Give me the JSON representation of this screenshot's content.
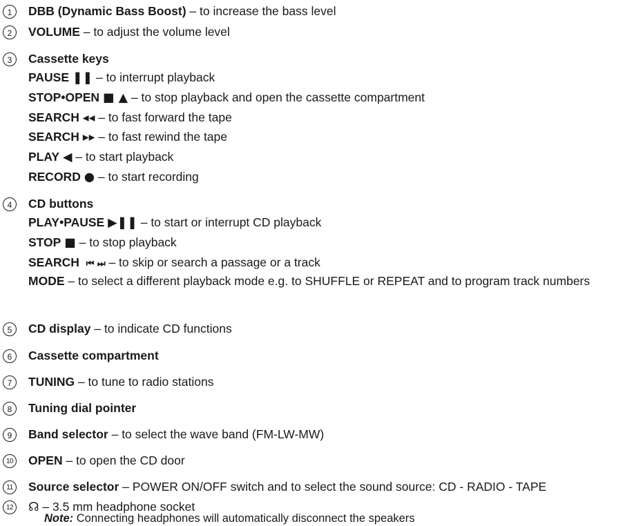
{
  "items": [
    {
      "n": "1",
      "bold": "DBB (Dynamic Bass Boost)",
      "text": " – to increase the bass level"
    },
    {
      "n": "2",
      "bold": "VOLUME",
      "text": " – to adjust the volume level"
    },
    {
      "n": "3",
      "bold": "Cassette keys",
      "text": "",
      "subs": [
        {
          "bold": "PAUSE",
          "sym": "❚❚",
          "text": " –  to interrupt playback"
        },
        {
          "bold": "STOP•OPEN",
          "sym": "■ ▲",
          "text": " – to stop playback and open the cassette compartment"
        },
        {
          "bold": "SEARCH",
          "sym": "◂◂",
          "text": " – to fast forward the tape"
        },
        {
          "bold": "SEARCH",
          "sym": "▸▸",
          "text": " – to fast rewind the tape"
        },
        {
          "bold": "PLAY",
          "sym": "◀",
          "text": " – to start playback"
        },
        {
          "bold": "RECORD",
          "sym": "●",
          "text": " – to start recording"
        }
      ]
    },
    {
      "n": "4",
      "bold": "CD buttons",
      "text": "",
      "subs": [
        {
          "bold": "PLAY•PAUSE",
          "sym": "▶❚❚",
          "text": " – to start or interrupt CD playback"
        },
        {
          "bold": "STOP",
          "sym": "■",
          "text": " – to stop playback"
        },
        {
          "bold": "SEARCH",
          "sym": "⏮ ⏭",
          "text": " – to skip or search a passage or a track"
        },
        {
          "bold": "MODE",
          "sym": "",
          "text": " – to select a different playback mode e.g. to SHUFFLE or REPEAT and to program track numbers"
        }
      ]
    },
    {
      "n": "5",
      "bold": "CD display",
      "text": " – to indicate CD functions"
    },
    {
      "n": "6",
      "bold": "Cassette compartment",
      "text": ""
    },
    {
      "n": "7",
      "bold": "TUNING",
      "text": " – to tune to radio stations"
    },
    {
      "n": "8",
      "bold": "Tuning dial pointer",
      "text": ""
    },
    {
      "n": "9",
      "bold": "Band selector",
      "text": " – to select the wave band (FM-LW-MW)"
    },
    {
      "n": "10",
      "bold": "OPEN",
      "text": " – to open the CD door"
    },
    {
      "n": "11",
      "bold": "Source selector",
      "text": " –  POWER ON/OFF switch and to select the sound source: CD - RADIO - TAPE"
    },
    {
      "n": "12",
      "bold": "",
      "sym": "☊",
      "text": " – 3.5 mm headphone socket"
    }
  ],
  "note": {
    "label": "Note:",
    "text": " Connecting headphones will automatically disconnect the speakers"
  }
}
